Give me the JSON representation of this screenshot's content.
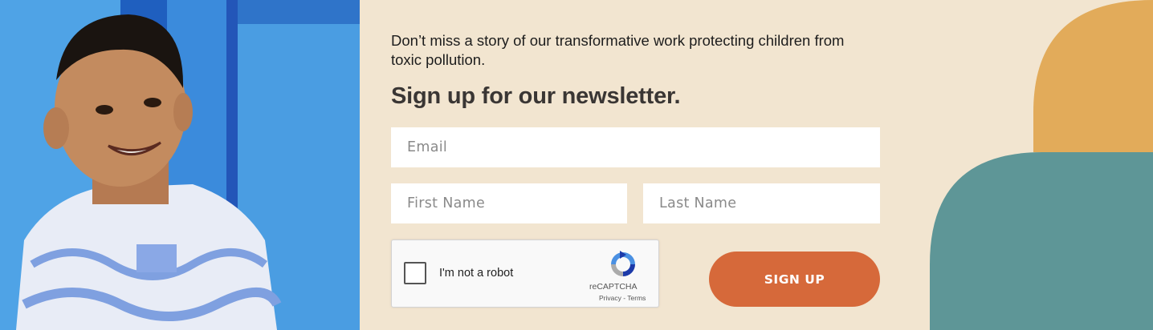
{
  "photo": {
    "alt_subject": "smiling-child-photo"
  },
  "intro_text": "Don’t miss a story of our transformative work protecting children from toxic pollution.",
  "heading": "Sign up for our newsletter.",
  "form": {
    "email_placeholder": "Email",
    "first_name_placeholder": "First Name",
    "last_name_placeholder": "Last Name",
    "submit_label": "SIGN UP"
  },
  "captcha": {
    "checkbox_label": "I'm not a robot",
    "brand": "reCAPTCHA",
    "privacy_link": "Privacy",
    "separator": " - ",
    "terms_link": "Terms",
    "logo_icon": "recaptcha-icon"
  },
  "colors": {
    "background": "#f2e5d0",
    "button": "#d6693a",
    "shape_orange": "#e2ab5a",
    "shape_teal": "#5e9697",
    "heading": "#3a3634"
  }
}
